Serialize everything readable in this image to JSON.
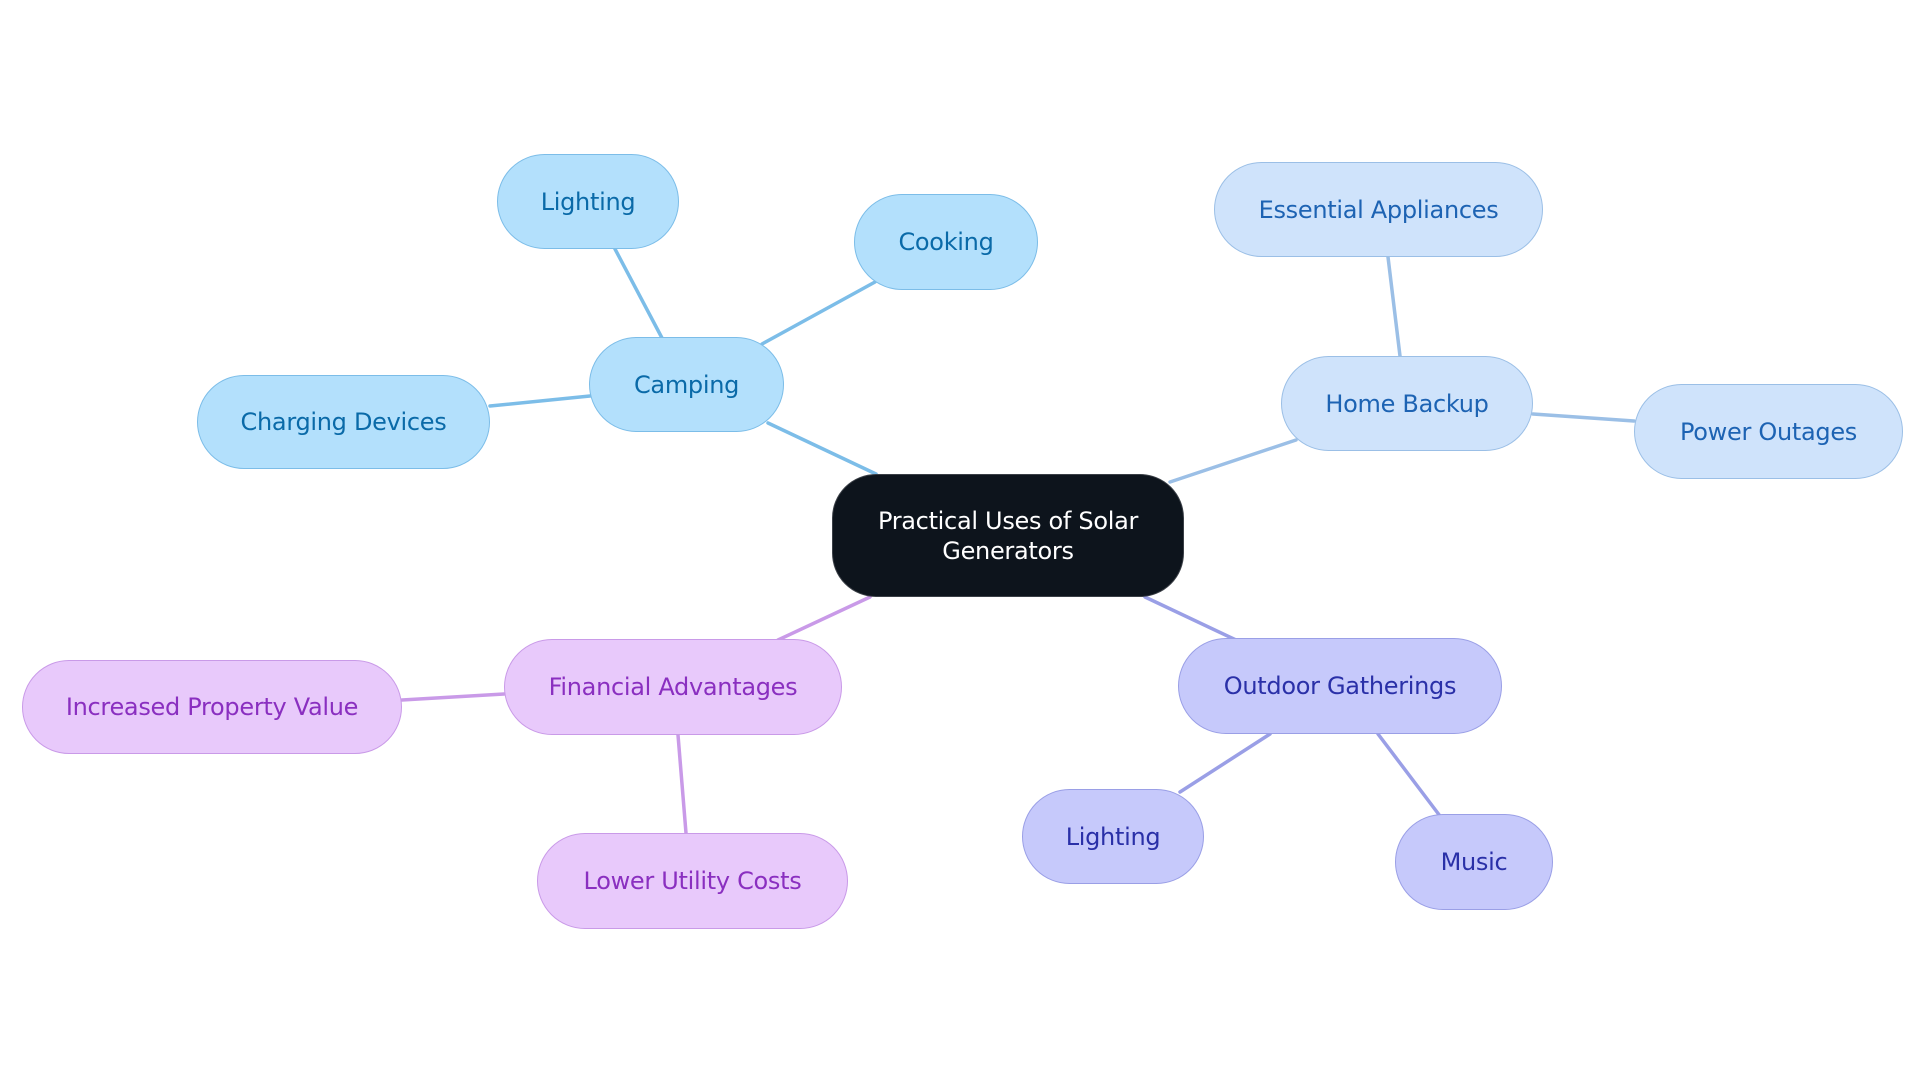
{
  "diagram": {
    "type": "mindmap",
    "title": "Practical Uses of Solar Generators",
    "root": {
      "id": "root",
      "label": "Practical Uses of Solar Generators",
      "style": {
        "fill": "#0d141c",
        "stroke": "#3a3f46",
        "text": "#ffffff"
      }
    },
    "branches": [
      {
        "id": "camping",
        "label": "Camping",
        "style": {
          "fill": "#b3e0fc",
          "stroke": "#7cbde8",
          "text": "#0a6aa8",
          "edge": "#7cbde8"
        },
        "children": [
          {
            "id": "camping-lighting",
            "label": "Lighting"
          },
          {
            "id": "camping-cooking",
            "label": "Cooking"
          },
          {
            "id": "camping-charging",
            "label": "Charging Devices"
          }
        ]
      },
      {
        "id": "home-backup",
        "label": "Home Backup",
        "style": {
          "fill": "#cfe3fb",
          "stroke": "#9bbfe6",
          "text": "#1d63b3",
          "edge": "#9bbfe6"
        },
        "children": [
          {
            "id": "home-essential",
            "label": "Essential Appliances"
          },
          {
            "id": "home-outages",
            "label": "Power Outages"
          }
        ]
      },
      {
        "id": "financial",
        "label": "Financial Advantages",
        "style": {
          "fill": "#e8c9fb",
          "stroke": "#c99ae8",
          "text": "#8a2fc0",
          "edge": "#c99ae8"
        },
        "children": [
          {
            "id": "fin-property",
            "label": "Increased Property Value"
          },
          {
            "id": "fin-utility",
            "label": "Lower Utility Costs"
          }
        ]
      },
      {
        "id": "outdoor",
        "label": "Outdoor Gatherings",
        "style": {
          "fill": "#c6c9fb",
          "stroke": "#9a9fe6",
          "text": "#2a30a8",
          "edge": "#9a9fe6"
        },
        "children": [
          {
            "id": "out-lighting",
            "label": "Lighting"
          },
          {
            "id": "out-music",
            "label": "Music"
          }
        ]
      }
    ]
  }
}
